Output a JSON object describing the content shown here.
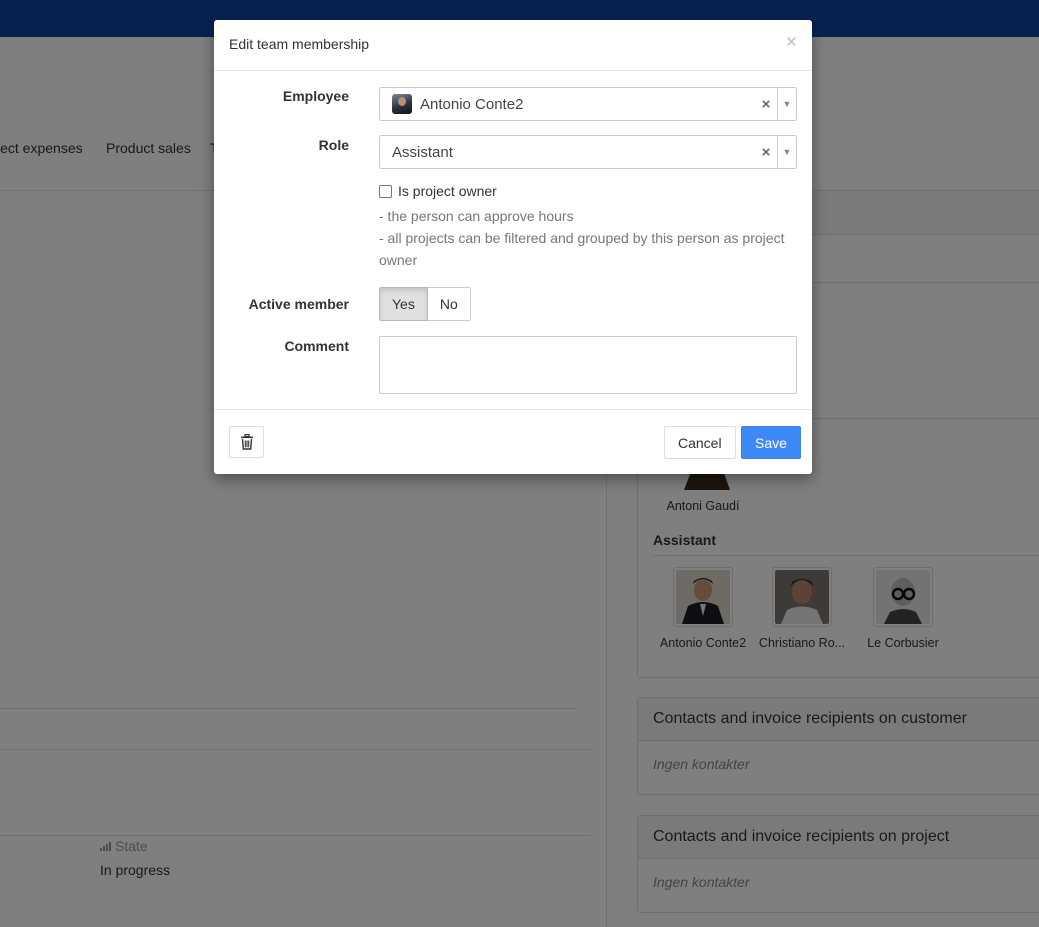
{
  "background": {
    "tabs": [
      {
        "label": "ject expenses"
      },
      {
        "label": "Product sales"
      },
      {
        "label": "T"
      }
    ],
    "team_panel": {
      "visible_member_above": "Antoni Gaudí",
      "role_heading": "Assistant",
      "members": [
        {
          "name": "Antonio Conte2"
        },
        {
          "name": "Christiano Ro..."
        },
        {
          "name": "Le Corbusier"
        }
      ]
    },
    "customer_contacts": {
      "title": "Contacts and invoice recipients on customer",
      "empty_text": "Ingen kontakter"
    },
    "project_contacts": {
      "title": "Contacts and invoice recipients on project",
      "empty_text": "Ingen kontakter"
    },
    "state": {
      "label": "State",
      "value": "In progress"
    }
  },
  "modal": {
    "title": "Edit team membership",
    "close_symbol": "×",
    "employee": {
      "label": "Employee",
      "value": "Antonio Conte2",
      "clear_symbol": "×",
      "arrow_symbol": "▼"
    },
    "role": {
      "label": "Role",
      "value": "Assistant",
      "clear_symbol": "×",
      "arrow_symbol": "▼"
    },
    "project_owner": {
      "label": "Is project owner",
      "checked": false,
      "help_line_1": "- the person can approve hours",
      "help_line_2": "- all projects can be filtered and grouped by this person as project owner"
    },
    "active_member": {
      "label": "Active member",
      "yes_label": "Yes",
      "no_label": "No",
      "selected": "Yes"
    },
    "comment": {
      "label": "Comment",
      "value": ""
    },
    "footer": {
      "cancel_label": "Cancel",
      "save_label": "Save"
    }
  },
  "colors": {
    "topbar": "#0d47a1",
    "primary_button": "#3d8af7"
  }
}
